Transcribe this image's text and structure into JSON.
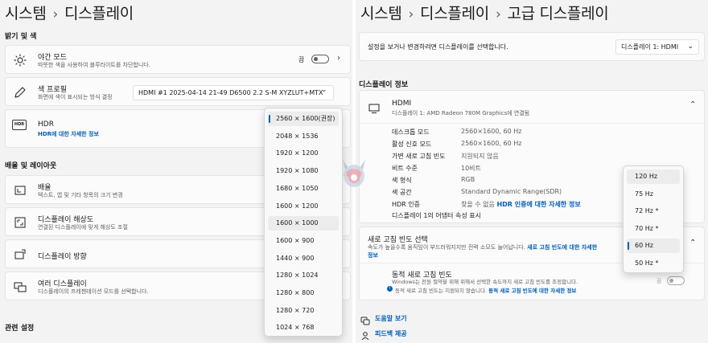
{
  "left": {
    "breadcrumb": {
      "parent": "시스템",
      "separator": "›",
      "current": "디스플레이"
    },
    "brightness_section": "밝기 및 색",
    "night_mode": {
      "title": "야간 모드",
      "sub": "따뜻한 색을 사용하여 블루라이트를 차단합니다.",
      "state": "끔",
      "icon": "brightness-icon"
    },
    "color_profile": {
      "title": "색 프로필",
      "sub": "화면에 색이 표시되는 방식 결정",
      "value": "HDMI #1 2025-04-14 21-49 D6500 2.2 S-M XYZLUT+MTX",
      "icon": "pen-icon"
    },
    "hdr": {
      "title": "HDR",
      "link": "HDR에 대한 자세한 정보",
      "icon": "hdr-icon"
    },
    "layout_section": "배율 및 레이아웃",
    "scale": {
      "title": "배율",
      "sub": "텍스트, 앱 및 기타 항목의 크기 변경",
      "icon": "scale-icon"
    },
    "resolution": {
      "title": "디스플레이 해상도",
      "sub": "연결된 디스플레이에 맞게 해상도 조절",
      "icon": "resolution-icon"
    },
    "orientation": {
      "title": "디스플레이 방향",
      "icon": "orientation-icon"
    },
    "multi_display": {
      "title": "여러 디스플레이",
      "sub": "디스플레이의 프레젠테이션 모드를 선택합니다.",
      "icon": "multi-display-icon"
    },
    "related_section": "관련 설정",
    "resolution_options": [
      "2560 × 1600(권장)",
      "2048 × 1536",
      "1920 × 1200",
      "1920 × 1080",
      "1680 × 1050",
      "1600 × 1200",
      "1600 × 1000",
      "1600 × 900",
      "1440 × 900",
      "1280 × 1024",
      "1280 × 800",
      "1280 × 720",
      "1024 × 768"
    ],
    "resolution_selected": "2560 × 1600(권장)",
    "resolution_hovered": "1600 × 1000"
  },
  "right": {
    "breadcrumb": {
      "a": "시스템",
      "b": "디스플레이",
      "c": "고급 디스플레이",
      "separator": "›"
    },
    "select_prompt": "설정을 보거나 변경하려면 디스플레이를 선택합니다.",
    "display_select": "디스플레이 1: HDMI",
    "info_section": "디스플레이 정보",
    "monitor": {
      "title": "HDMI",
      "sub": "디스플레이 1: AMD Radeon 780M Graphics에 연결됨",
      "icon": "monitor-icon"
    },
    "info_rows": [
      {
        "label": "데스크톱 모드",
        "value": "2560×1600, 60 Hz"
      },
      {
        "label": "활성 신호 모드",
        "value": "2560×1600, 60 Hz"
      },
      {
        "label": "가변 새로 고침 빈도",
        "value": "지원되지 않음"
      },
      {
        "label": "비트 수준",
        "value": "10비트"
      },
      {
        "label": "색 형식",
        "value": "RGB"
      },
      {
        "label": "색 공간",
        "value": "Standard Dynamic Range(SDR)"
      }
    ],
    "hdr_cert": {
      "label": "HDR 인증",
      "value": "찾을 수 없음",
      "link": "HDR 인증에 대한 자세한 정보"
    },
    "adapter_link": "디스플레이 1의 어댑터 속성 표시",
    "refresh": {
      "title": "새로 고침 빈도 선택",
      "sub": "속도가 높을수록 움직임이 부드러워지지만 전력 소모도 늘어납니다.",
      "link1": "새로 고침 빈도에 대한 자세한",
      "link2": "정보",
      "options": [
        "120 Hz",
        "75 Hz",
        "72 Hz *",
        "70 Hz *",
        "60 Hz",
        "50 Hz *"
      ],
      "selected": "60 Hz",
      "hovered": "120 Hz"
    },
    "dynamic": {
      "title": "동적 새로 고침 빈도",
      "sub": "Windows는 전원 절약을 위해 위해서 선택한 속도까지 새로 고침 빈도를 조정합니다.",
      "note": "동적 새로 고침 빈도는 지원되지 않습니다.",
      "note_link": "동적 새로 고침 빈도에 대한 자세한 정보",
      "state": "끔"
    },
    "help": "도움말 보기",
    "feedback": "피드백 제공"
  }
}
